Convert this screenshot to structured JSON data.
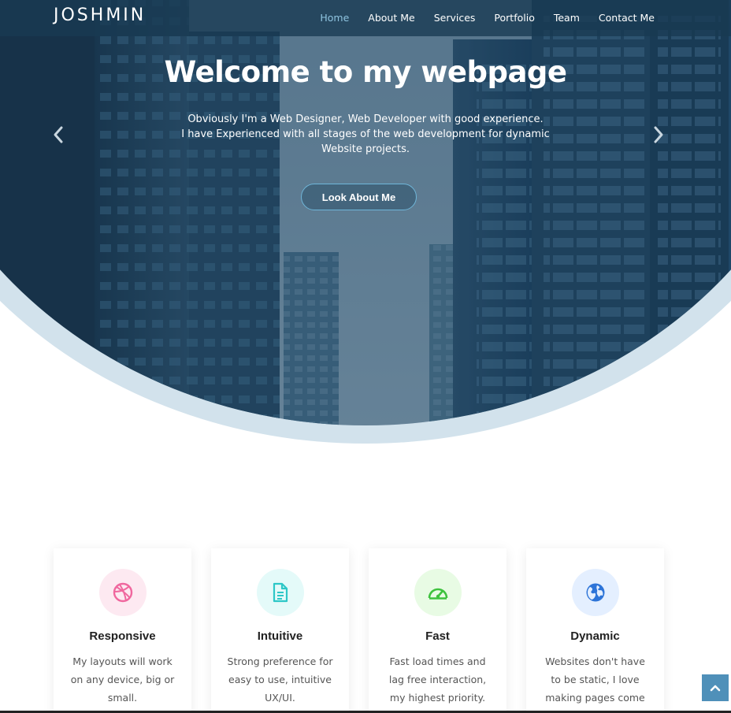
{
  "brand": {
    "logo": "JOSHMIN"
  },
  "nav": {
    "items": [
      {
        "label": "Home",
        "active": true
      },
      {
        "label": "About Me",
        "active": false
      },
      {
        "label": "Services",
        "active": false
      },
      {
        "label": "Portfolio",
        "active": false
      },
      {
        "label": "Team",
        "active": false
      },
      {
        "label": "Contact Me",
        "active": false
      }
    ]
  },
  "hero": {
    "title": "Welcome to my webpage",
    "line1": "Obviously I'm a Web Designer, Web Developer with good experience.",
    "line2": "I have Experienced with all stages of the web development for dynamic",
    "line3": "Website projects.",
    "button_label": "Look About Me",
    "prev_icon": "chevron-left-icon",
    "next_icon": "chevron-right-icon"
  },
  "features": [
    {
      "title": "Responsive",
      "text": "My layouts will work on any device, big or small.",
      "icon": "dribbble-icon",
      "icon_color": "#f0679e",
      "icon_bg": "#fde9f1"
    },
    {
      "title": "Intuitive",
      "text": "Strong preference for easy to use, intuitive UX/UI.",
      "icon": "document-icon",
      "icon_color": "#2dc7c7",
      "icon_bg": "#e4faf9"
    },
    {
      "title": "Fast",
      "text": "Fast load times and lag free interaction, my highest priority.",
      "icon": "speedometer-icon",
      "icon_color": "#3ec23e",
      "icon_bg": "#e8fbe4"
    },
    {
      "title": "Dynamic",
      "text": "Websites don't have to be static, I love making pages come",
      "icon": "globe-icon",
      "icon_color": "#2d74d8",
      "icon_bg": "#e4efff"
    }
  ],
  "colors": {
    "accent": "#4f90b9",
    "nav_bg": "#183a52",
    "active_link": "#8fc4e0",
    "hero_rim": "#d2e2ec"
  },
  "back_to_top": {
    "icon": "chevron-up-icon"
  }
}
